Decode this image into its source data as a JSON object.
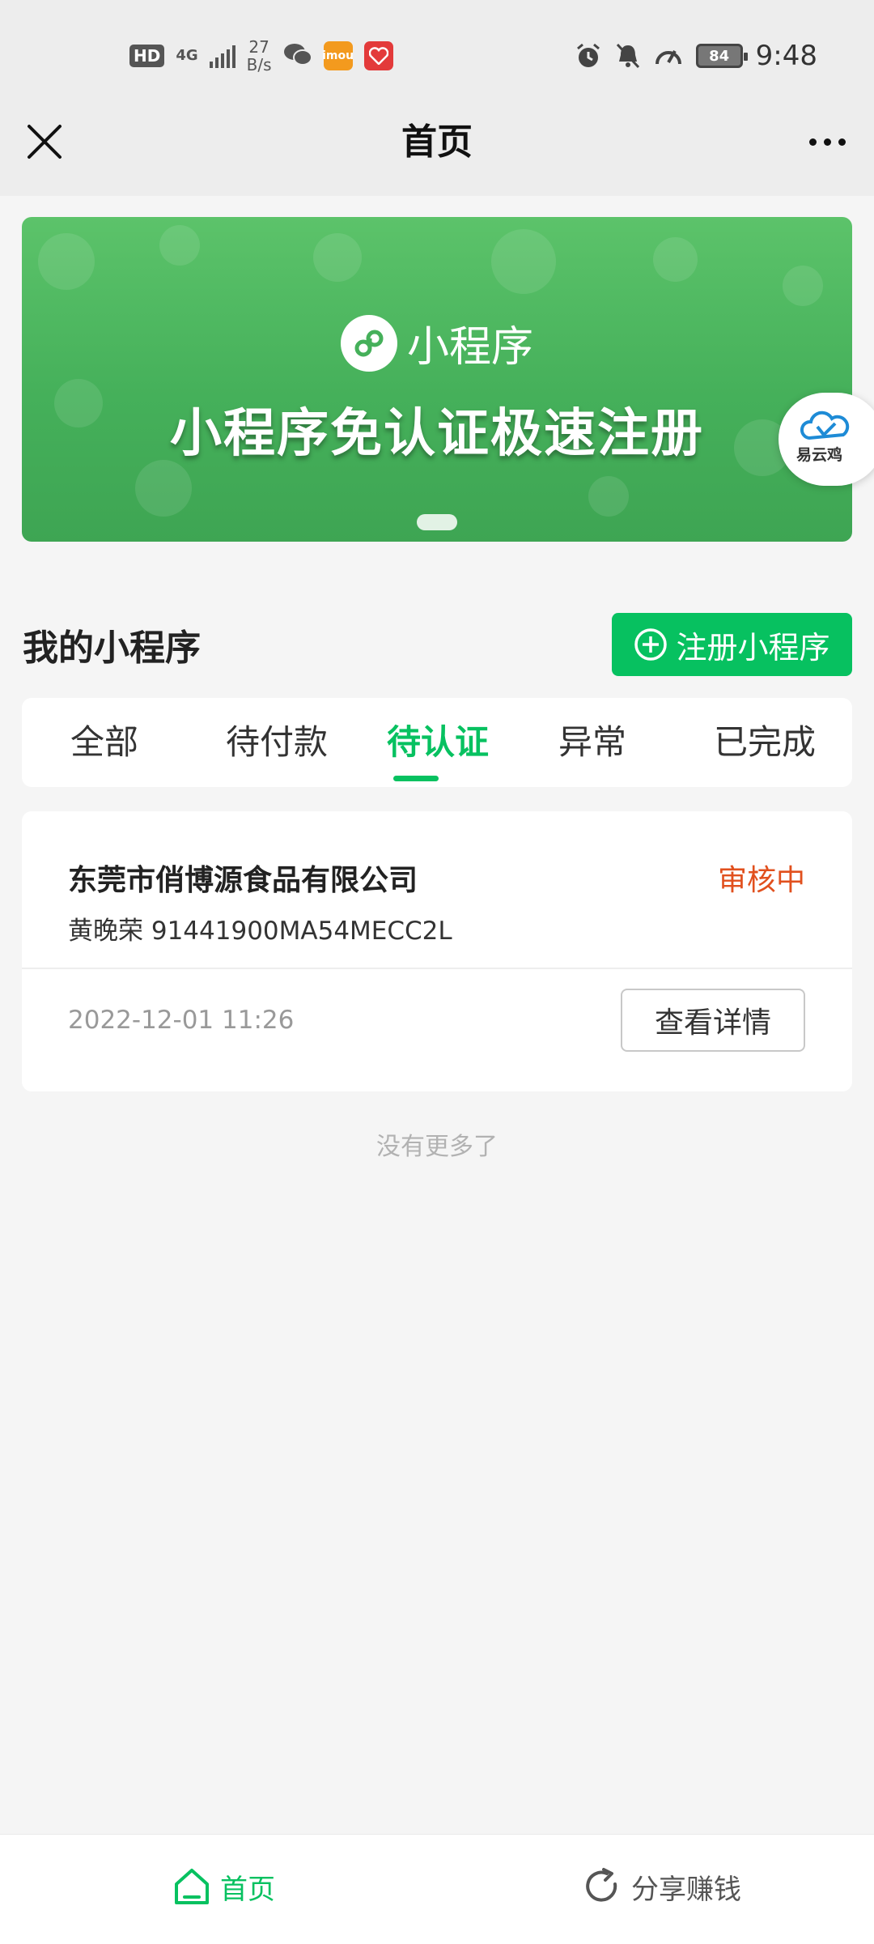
{
  "status_bar": {
    "hd": "HD",
    "network": "4G",
    "speed_value": "27",
    "speed_unit": "B/s",
    "app_icon_imou": "imou",
    "battery": "84",
    "time": "9:48",
    "icons": [
      "wechat-icon",
      "imou-icon",
      "heart-app-icon",
      "alarm-icon",
      "bell-muted-icon",
      "speedometer-icon",
      "battery-icon"
    ]
  },
  "nav": {
    "title": "首页"
  },
  "banner": {
    "brand": "小程序",
    "headline": "小程序免认证极速注册",
    "float_logo_text": "易云鸡",
    "colors": {
      "start": "#5cc36a",
      "end": "#3ea553"
    }
  },
  "section": {
    "title": "我的小程序",
    "register_button": "注册小程序"
  },
  "tabs": [
    {
      "label": "全部"
    },
    {
      "label": "待付款"
    },
    {
      "label": "待认证",
      "active": true
    },
    {
      "label": "异常"
    },
    {
      "label": "已完成"
    }
  ],
  "card": {
    "company": "东莞市俏博源食品有限公司",
    "status": "审核中",
    "person": "黄晚荣 91441900MA54MECC2L",
    "time": "2022-12-01 11:26",
    "detail_button": "查看详情"
  },
  "list_end": "没有更多了",
  "bottom_nav": {
    "home": "首页",
    "share": "分享赚钱"
  },
  "colors": {
    "accent": "#07c160",
    "status": "#e1501e"
  }
}
